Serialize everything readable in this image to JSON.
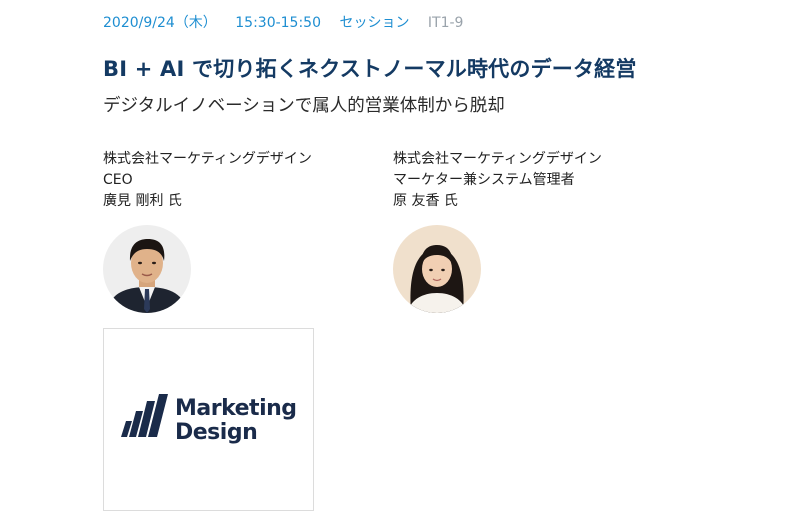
{
  "session": {
    "date": "2020/9/24（木）",
    "time": "15:30-15:50",
    "type": "セッション",
    "code": "IT1-9"
  },
  "title": "BI + AI で切り拓くネクストノーマル時代のデータ経営",
  "subtitle": "デジタルイノベーションで属人的営業体制から脱却",
  "speakers": [
    {
      "company": "株式会社マーケティングデザイン",
      "role": "CEO",
      "name": "廣見 剛利 氏"
    },
    {
      "company": "株式会社マーケティングデザイン",
      "role": "マーケター兼システム管理者",
      "name": "原 友香 氏"
    }
  ],
  "logo": {
    "line1": "Marketing",
    "line2": "Design",
    "color": "#1a2b4a"
  }
}
